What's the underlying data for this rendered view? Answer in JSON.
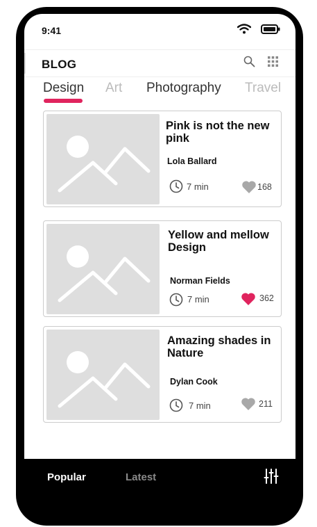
{
  "status": {
    "time": "9:41",
    "icons": [
      "wifi-icon",
      "battery-icon"
    ]
  },
  "header": {
    "title": "BLOG",
    "icons": [
      "search-icon",
      "grid-icon"
    ]
  },
  "tabs": [
    {
      "label": "Design",
      "active": true
    },
    {
      "label": "Art",
      "active": false
    },
    {
      "label": "Photography",
      "active": false
    },
    {
      "label": "Travel",
      "active": false
    }
  ],
  "posts": [
    {
      "title": "Pink is not the new pink",
      "author": "Lola Ballard",
      "read_time": "7 min",
      "likes": "168",
      "liked": false
    },
    {
      "title": "Yellow and mellow Design",
      "author": "Norman Fields",
      "read_time": "7 min",
      "likes": "362",
      "liked": true
    },
    {
      "title": "Amazing shades in Nature",
      "author": "Dylan Cook",
      "read_time": "7 min",
      "likes": "211",
      "liked": false
    }
  ],
  "bottom_nav": {
    "popular": "Popular",
    "latest": "Latest",
    "icon": "filter-icon"
  },
  "colors": {
    "accent": "#e0245e",
    "placeholder": "#dedede",
    "heart_inactive": "#a8a8a8"
  }
}
